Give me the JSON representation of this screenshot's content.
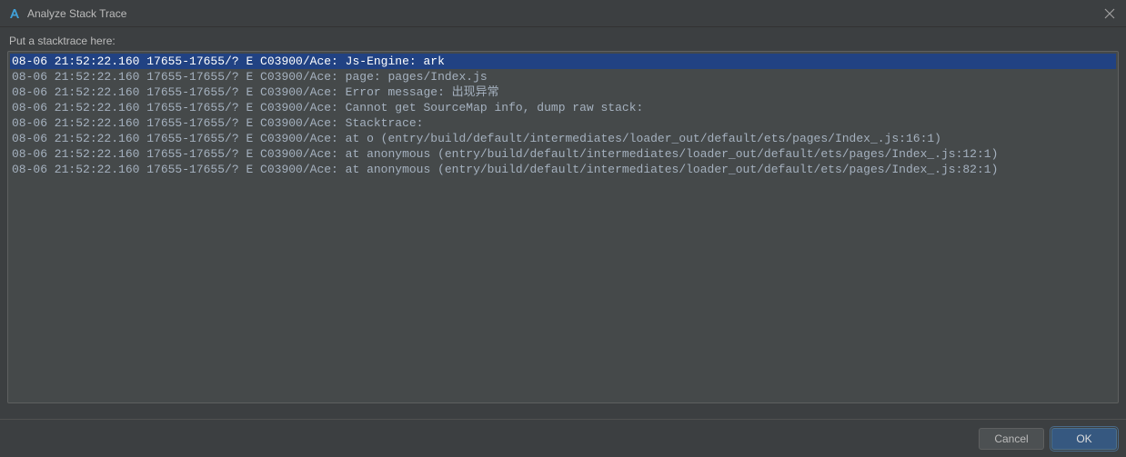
{
  "window": {
    "title": "Analyze Stack Trace"
  },
  "label": "Put a stacktrace here:",
  "stacktrace": {
    "lines": [
      "08-06 21:52:22.160 17655-17655/? E C03900/Ace: Js-Engine: ark",
      "08-06 21:52:22.160 17655-17655/? E C03900/Ace: page: pages/Index.js",
      "08-06 21:52:22.160 17655-17655/? E C03900/Ace: Error message: 出现异常",
      "08-06 21:52:22.160 17655-17655/? E C03900/Ace: Cannot get SourceMap info, dump raw stack:",
      "08-06 21:52:22.160 17655-17655/? E C03900/Ace: Stacktrace:",
      "08-06 21:52:22.160 17655-17655/? E C03900/Ace: at o (entry/build/default/intermediates/loader_out/default/ets/pages/Index_.js:16:1)",
      "08-06 21:52:22.160 17655-17655/? E C03900/Ace: at anonymous (entry/build/default/intermediates/loader_out/default/ets/pages/Index_.js:12:1)",
      "08-06 21:52:22.160 17655-17655/? E C03900/Ace: at anonymous (entry/build/default/intermediates/loader_out/default/ets/pages/Index_.js:82:1)"
    ],
    "selected_index": 0
  },
  "buttons": {
    "cancel": "Cancel",
    "ok": "OK"
  }
}
